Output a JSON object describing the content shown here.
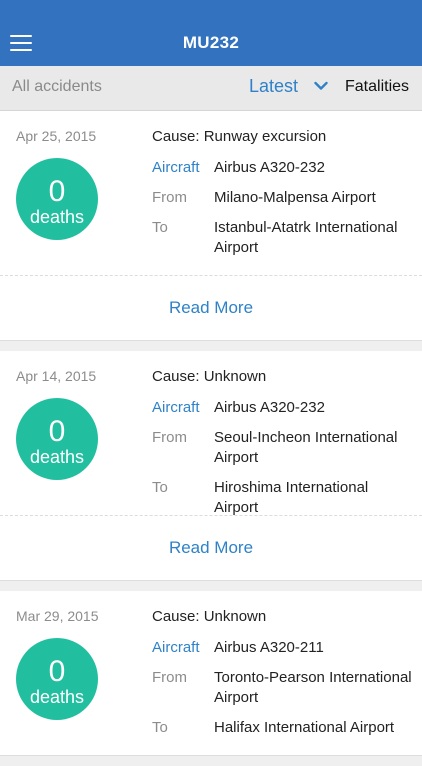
{
  "header": {
    "title": "MU232"
  },
  "filters": {
    "all_label": "All accidents",
    "sort_label": "Latest",
    "type_label": "Fatalities"
  },
  "labels": {
    "aircraft": "Aircraft",
    "from": "From",
    "to": "To",
    "deaths": "deaths",
    "read_more": "Read More"
  },
  "accidents": [
    {
      "date": "Apr 25, 2015",
      "deaths": "0",
      "cause": "Cause: Runway excursion",
      "aircraft": "Airbus A320-232",
      "from": "Milano-Malpensa Airport",
      "to": "Istanbul-Atatrk International Airport"
    },
    {
      "date": "Apr 14, 2015",
      "deaths": "0",
      "cause": "Cause: Unknown",
      "aircraft": "Airbus A320-232",
      "from": "Seoul-Incheon International Airport",
      "to": "Hiroshima International Airport"
    },
    {
      "date": "Mar 29, 2015",
      "deaths": "0",
      "cause": "Cause: Unknown",
      "aircraft": "Airbus A320-211",
      "from": "Toronto-Pearson International Airport",
      "to": "Halifax International Airport"
    }
  ],
  "colors": {
    "header_bg": "#3272bf",
    "accent": "#2f82c8",
    "deaths_circle": "#21bfa0"
  }
}
